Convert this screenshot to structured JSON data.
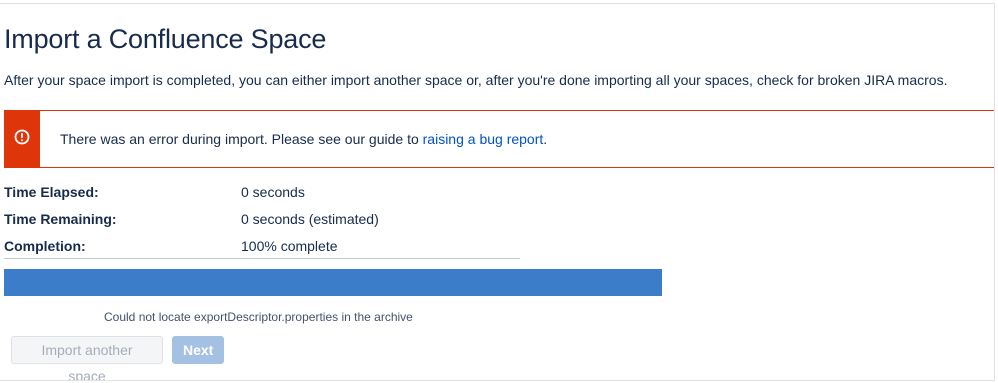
{
  "page": {
    "title": "Import a Confluence Space",
    "subtitle": "After your space import is completed, you can either import another space or, after you're done importing all your spaces, check for broken JIRA macros."
  },
  "error": {
    "icon": "warning-circle-icon",
    "message": "There was an error during import. Please see our guide to ",
    "link_text": "raising a bug report",
    "suffix": ".",
    "color": "#de350b"
  },
  "stats": [
    {
      "label": "Time Elapsed:",
      "value": "0 seconds"
    },
    {
      "label": "Time Remaining:",
      "value": "0 seconds (estimated)"
    },
    {
      "label": "Completion:",
      "value": "100% complete"
    }
  ],
  "progress": {
    "fraction": 1.0,
    "color": "#3b7dc8"
  },
  "status_note": "Could not locate exportDescriptor.properties in the archive",
  "buttons": {
    "import_another": "Import another space",
    "next": "Next"
  }
}
